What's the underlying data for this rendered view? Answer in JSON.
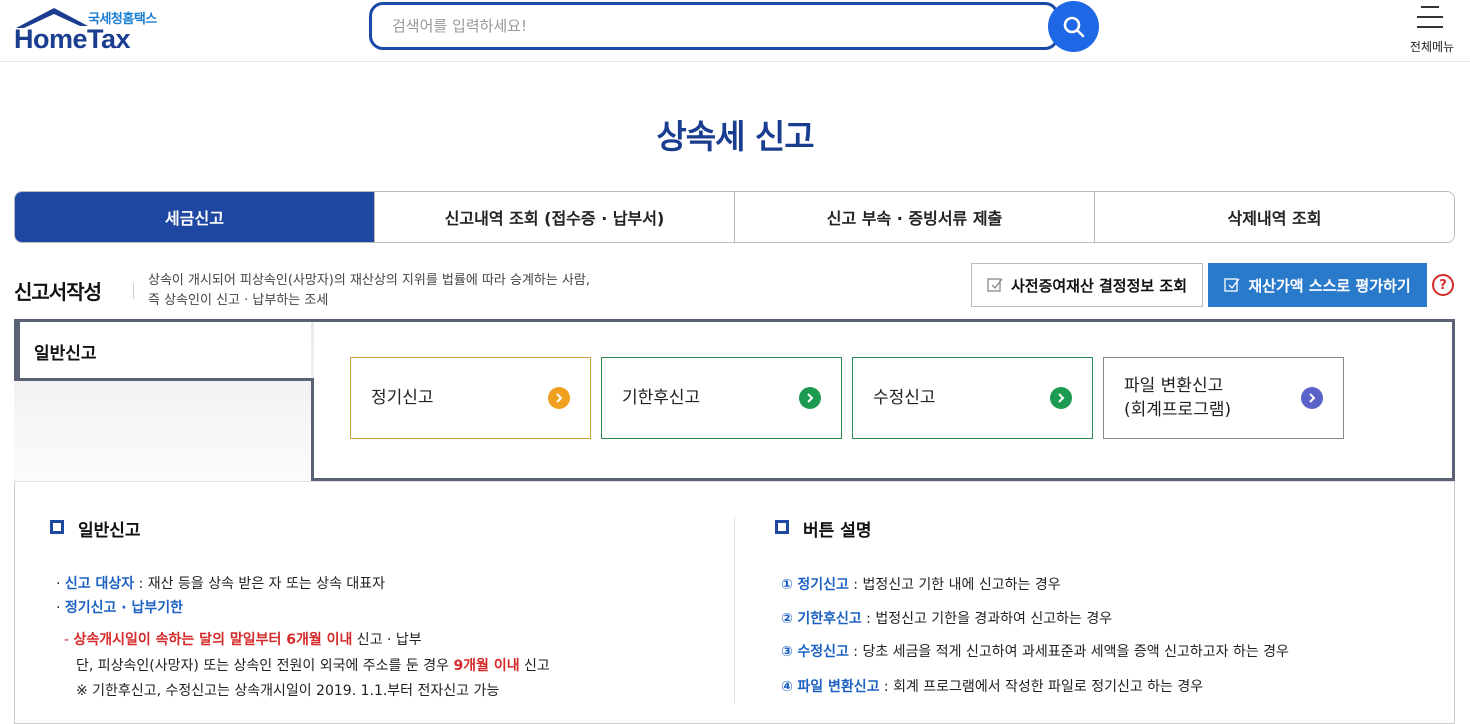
{
  "header": {
    "logo_sub": "국세청홈택스",
    "logo_main": "HomeTax",
    "search_placeholder": "검색어를 입력하세요!",
    "menu_label": "전체메뉴"
  },
  "page": {
    "title": "상속세 신고"
  },
  "tabs": [
    {
      "label": "세금신고",
      "active": true
    },
    {
      "label": "신고내역 조회 (접수증 · 납부서)",
      "active": false
    },
    {
      "label": "신고 부속 · 증빙서류 제출",
      "active": false
    },
    {
      "label": "삭제내역 조회",
      "active": false
    }
  ],
  "section": {
    "title": "신고서작성",
    "desc_line1": "상속이 개시되어 피상속인(사망자)의 재산상의 지위를 법률에 따라 승계하는 사람,",
    "desc_line2": "즉 상속인이 신고 · 납부하는 조세",
    "prior_button": "사전증여재산 결정정보 조회",
    "eval_button": "재산가액 스스로 평가하기",
    "help": "?"
  },
  "filing": {
    "label": "일반신고",
    "options": [
      {
        "label": "정기신고",
        "label2": "",
        "color": "#f0a020",
        "border": "#c9a040"
      },
      {
        "label": "기한후신고",
        "label2": "",
        "color": "#1c9a52",
        "border": "#2e8b57"
      },
      {
        "label": "수정신고",
        "label2": "",
        "color": "#1c9a52",
        "border": "#2e8b57"
      },
      {
        "label": "파일 변환신고",
        "label2": "(회계프로그램)",
        "color": "#5a62c8",
        "border": "#8a8a8a"
      }
    ]
  },
  "info_left": {
    "title": "일반신고",
    "target_label": "신고 대상자",
    "target_text": " : 재산 등을 상속 받은 자 또는 상속 대표자",
    "deadline_label": "정기신고 · 납부기한",
    "deadline_red": "상속개시일이 속하는 달의 말일부터 6개월 이내",
    "deadline_text": " 신고 · 납부",
    "abroad_text": "단, 피상속인(사망자) 또는 상속인 전원이 외국에 주소를 둔 경우 ",
    "abroad_red": "9개월 이내",
    "abroad_tail": " 신고",
    "note": "※ 기한후신고, 수정신고는 상속개시일이 2019. 1.1.부터 전자신고 가능"
  },
  "info_right": {
    "title": "버튼 설명",
    "items": [
      {
        "num": "①",
        "label": "정기신고",
        "text": " : 법정신고 기한 내에 신고하는 경우"
      },
      {
        "num": "②",
        "label": "기한후신고",
        "text": " : 법정신고 기한을 경과하여 신고하는 경우"
      },
      {
        "num": "③",
        "label": "수정신고",
        "text": " : 당초 세금을 적게 신고하여 과세표준과 세액을 증액 신고하고자 하는 경우"
      },
      {
        "num": "④",
        "label": "파일 변환신고",
        "text": " : 회계 프로그램에서 작성한 파일로 정기신고 하는 경우"
      }
    ]
  }
}
